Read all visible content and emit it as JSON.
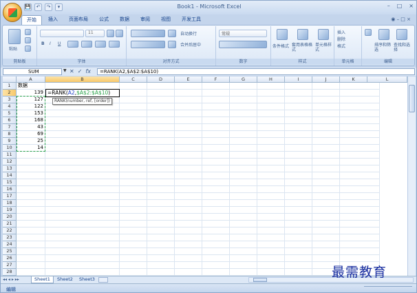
{
  "window": {
    "title": "Book1 - Microsoft Excel"
  },
  "quick_access": [
    "💾",
    "↶",
    "↷",
    "▾"
  ],
  "window_controls": [
    "–",
    "□",
    "×"
  ],
  "ribbon_tabs": [
    "开始",
    "插入",
    "页面布局",
    "公式",
    "数据",
    "审阅",
    "视图",
    "开发工具"
  ],
  "ribbon_right": "◉ – □ ×",
  "ribbon": {
    "clipboard": {
      "paste": "粘贴",
      "label": "剪贴板"
    },
    "font": {
      "size": "11",
      "label": "字体",
      "bold": "B",
      "italic": "I",
      "underline": "U"
    },
    "align": {
      "wrap": "自动换行",
      "merge": "合并后居中",
      "label": "对齐方式"
    },
    "number": {
      "format": "常规",
      "label": "数字"
    },
    "styles": {
      "cond": "条件格式",
      "table": "套用表格格式",
      "cell": "单元格样式",
      "label": "样式"
    },
    "cells": {
      "insert": "插入",
      "delete": "删除",
      "format": "格式",
      "label": "单元格"
    },
    "edit": {
      "sort": "排序和筛选",
      "find": "查找和选择",
      "label": "编辑"
    }
  },
  "formula_bar": {
    "name_box": "SUM",
    "formula": "=RANK(A2,$A$2:$A$10)"
  },
  "columns": [
    "A",
    "B",
    "C",
    "D",
    "E",
    "F",
    "G",
    "H",
    "I",
    "J",
    "K",
    "L"
  ],
  "rows": [
    {
      "n": "1",
      "a": "数据"
    },
    {
      "n": "2",
      "a": "139"
    },
    {
      "n": "3",
      "a": "127"
    },
    {
      "n": "4",
      "a": "122"
    },
    {
      "n": "5",
      "a": "153"
    },
    {
      "n": "6",
      "a": "168"
    },
    {
      "n": "7",
      "a": "43"
    },
    {
      "n": "8",
      "a": "69"
    },
    {
      "n": "9",
      "a": "25"
    },
    {
      "n": "10",
      "a": "14"
    },
    {
      "n": "11",
      "a": ""
    },
    {
      "n": "12",
      "a": ""
    },
    {
      "n": "13",
      "a": ""
    },
    {
      "n": "14",
      "a": ""
    },
    {
      "n": "15",
      "a": ""
    },
    {
      "n": "16",
      "a": ""
    },
    {
      "n": "17",
      "a": ""
    },
    {
      "n": "18",
      "a": ""
    },
    {
      "n": "19",
      "a": ""
    },
    {
      "n": "20",
      "a": ""
    },
    {
      "n": "21",
      "a": ""
    },
    {
      "n": "22",
      "a": ""
    },
    {
      "n": "23",
      "a": ""
    },
    {
      "n": "24",
      "a": ""
    },
    {
      "n": "25",
      "a": ""
    },
    {
      "n": "26",
      "a": ""
    },
    {
      "n": "27",
      "a": ""
    },
    {
      "n": "28",
      "a": ""
    }
  ],
  "editing": {
    "prefix": "=RANK(",
    "ref": "A2",
    "comma": ",",
    "range": "$A$2:$A$10",
    "suffix": ")",
    "tooltip": "RANK(number, ref, [order])"
  },
  "sheets": [
    "Sheet1",
    "Sheet2",
    "Sheet3"
  ],
  "sheet_nav": "◂◂ ◂ ▸ ▸▸",
  "status": "编辑",
  "watermark": "最需教育"
}
